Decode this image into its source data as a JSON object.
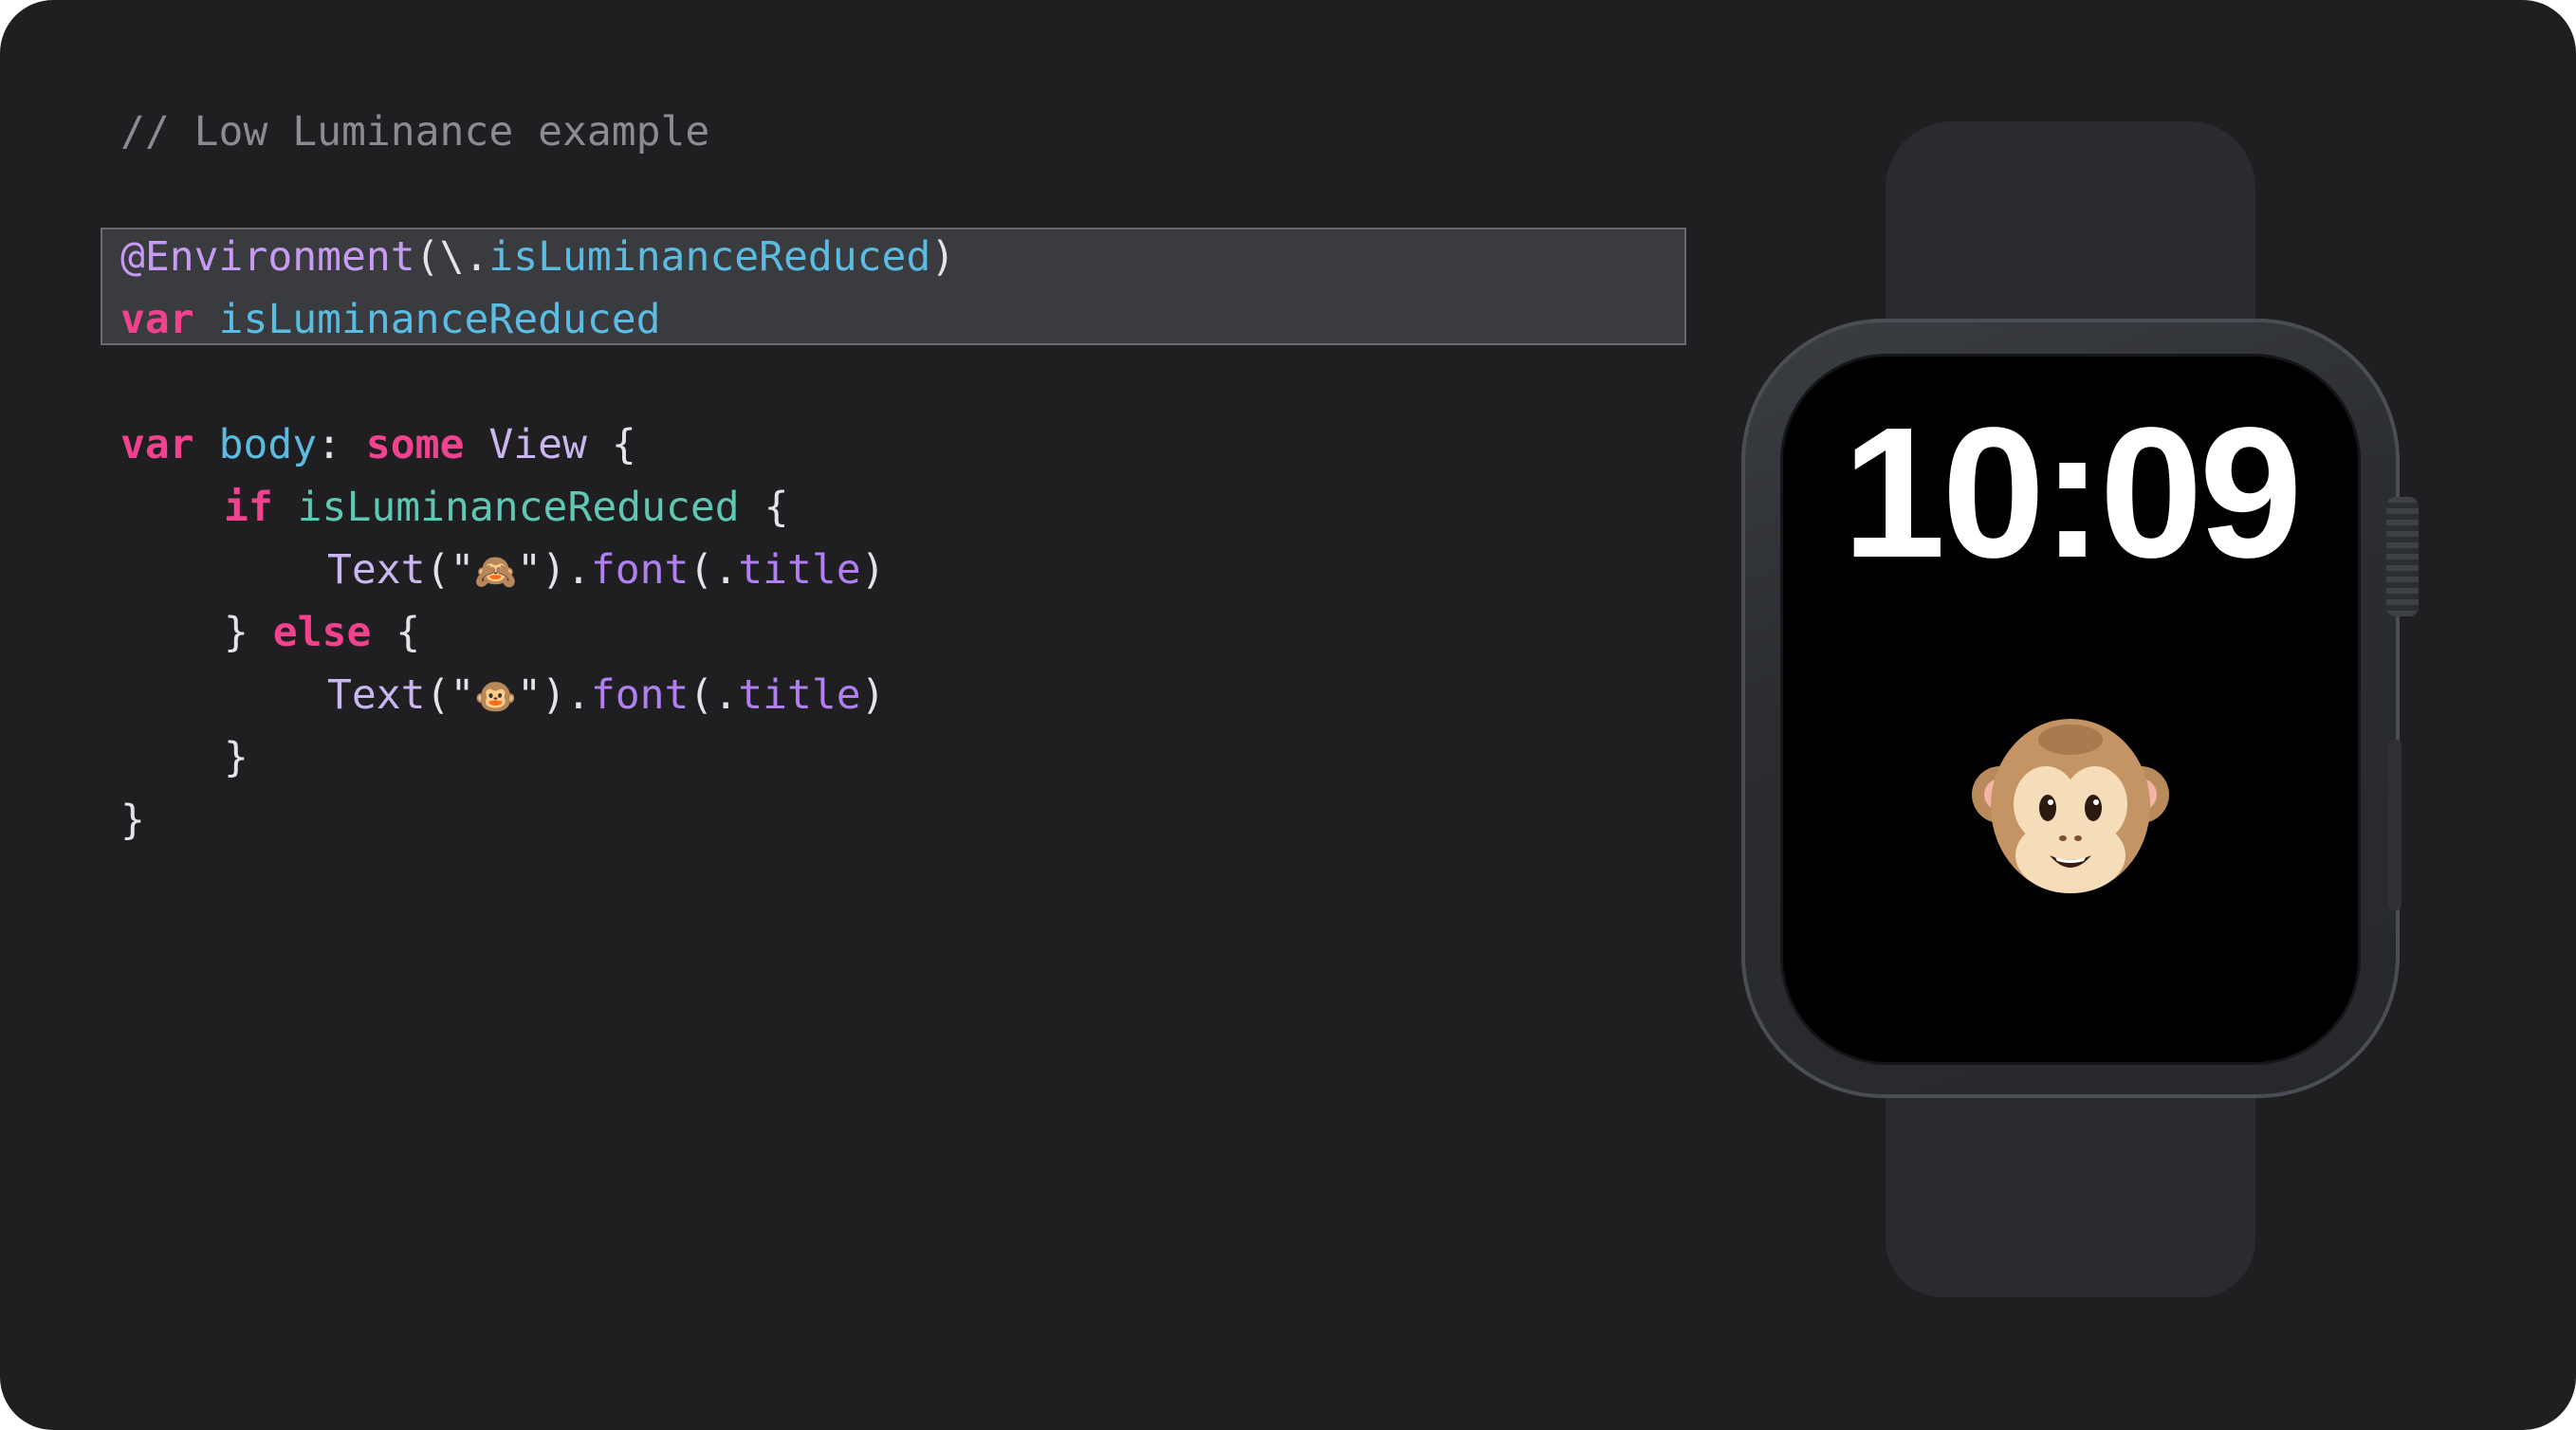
{
  "code": {
    "comment": "// Low Luminance example",
    "line1": {
      "attribute": "@Environment",
      "open": "(\\.",
      "key": "isLuminanceReduced",
      "close": ")"
    },
    "line2": {
      "kw": "var",
      "name": "isLuminanceReduced"
    },
    "line3": {
      "kw": "var",
      "name": "body",
      "colon": ":",
      "kw2": "some",
      "type": "View",
      "brace": "{"
    },
    "line4": {
      "kw": "if",
      "name": "isLuminanceReduced",
      "brace": "{"
    },
    "line5": {
      "call": "Text",
      "open": "(\"",
      "emoji": "🙈",
      "close": "\").",
      "fn": "font",
      "arg_open": "(.",
      "arg": "title",
      "arg_close": ")"
    },
    "line6": {
      "close": "}",
      "kw": "else",
      "brace": "{"
    },
    "line7": {
      "call": "Text",
      "open": "(\"",
      "emoji": "🐵",
      "close": "\").",
      "fn": "font",
      "arg_open": "(.",
      "arg": "title",
      "arg_close": ")"
    },
    "line8": {
      "close": "}"
    },
    "line9": {
      "close": "}"
    }
  },
  "watch": {
    "time": "10:09",
    "face_emoji": "monkey-face"
  },
  "colors": {
    "background": "#1f1f21",
    "keyword": "#f0428f",
    "attribute": "#c79bf4",
    "identifier": "#5bbbe0",
    "highlight": "#3a3b3f"
  }
}
